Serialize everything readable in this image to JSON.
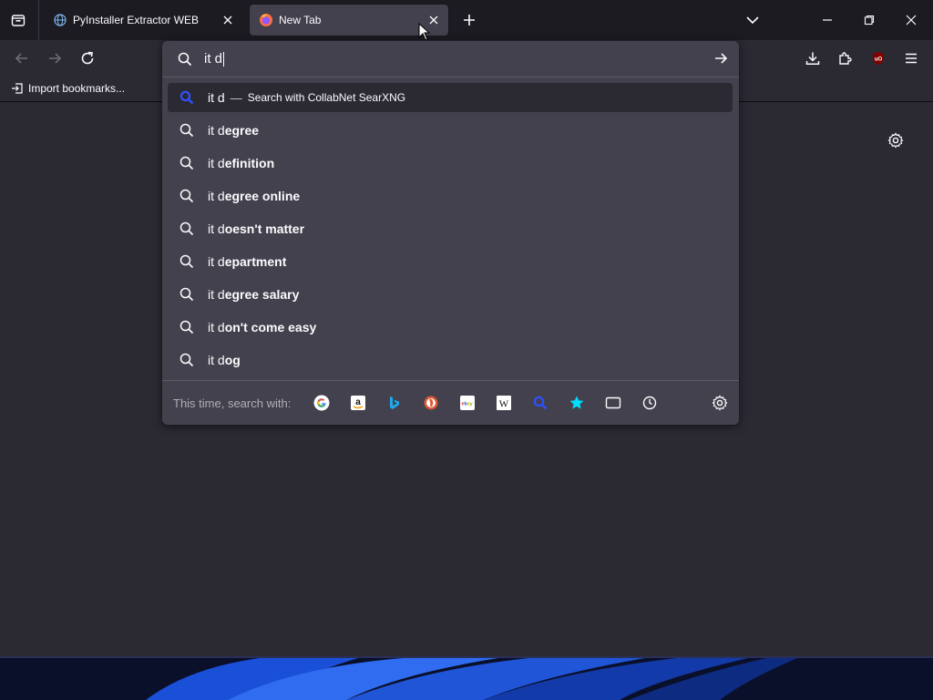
{
  "tabs": [
    {
      "title": "PyInstaller Extractor WEB",
      "favicon": "globe-icon"
    },
    {
      "title": "New Tab",
      "favicon": "firefox-icon",
      "active": true
    }
  ],
  "bookmarks_bar": {
    "import_label": "Import bookmarks..."
  },
  "urlbar": {
    "typed_text": "it d",
    "heuristic": {
      "query": "it d",
      "separator": "—",
      "action": "Search with CollabNet SearXNG"
    },
    "suggestions": [
      {
        "prefix": "it d",
        "completion": "egree"
      },
      {
        "prefix": "it d",
        "completion": "efinition"
      },
      {
        "prefix": "it d",
        "completion": "egree online"
      },
      {
        "prefix": "it d",
        "completion": "oesn't matter"
      },
      {
        "prefix": "it d",
        "completion": "epartment"
      },
      {
        "prefix": "it d",
        "completion": "egree salary"
      },
      {
        "prefix": "it d",
        "completion": "on't come easy"
      },
      {
        "prefix": "it d",
        "completion": "og"
      }
    ],
    "one_off_label": "This time, search with:",
    "engines": [
      "google",
      "amazon",
      "bing",
      "duckduckgo",
      "ebay",
      "wikipedia",
      "searxng",
      "bookmarks",
      "tabs",
      "history"
    ]
  },
  "colors": {
    "accent": "#0060df",
    "popup_bg": "#42414d",
    "toolbar_bg": "#2b2a33",
    "tabstrip_bg": "#1c1b22"
  }
}
